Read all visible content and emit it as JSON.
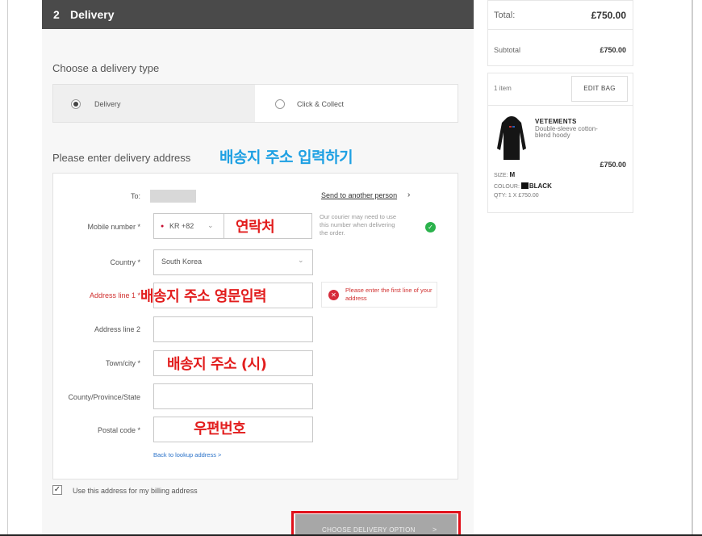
{
  "delivery_step": {
    "number": "2",
    "title": "Delivery"
  },
  "delivery_type": {
    "heading": "Choose a delivery type",
    "options": [
      {
        "label": "Delivery",
        "selected": true
      },
      {
        "label": "Click & Collect",
        "selected": false
      }
    ]
  },
  "address": {
    "heading": "Please enter delivery address",
    "to_label": "To:",
    "send_link": "Send to another person",
    "mobile_label": "Mobile number *",
    "phone_code": "KR +82",
    "courier_note": "Our courier may need to use this number when delivering the order.",
    "country_label": "Country *",
    "country_value": "South Korea",
    "line1_label": "Address line 1 *",
    "line1_error": "Please enter the first line of your address",
    "line2_label": "Address line 2",
    "town_label": "Town/city *",
    "county_label": "County/Province/State",
    "postal_label": "Postal code *",
    "back_link": "Back to lookup address >",
    "billing_label": "Use this address for my billing address",
    "cta_label": "CHOOSE DELIVERY OPTION",
    "cta_chevron": ">"
  },
  "annotations": {
    "address_heading": "배송지 주소 입력하기",
    "mobile": "연락처",
    "line1": "배송지 주소 영문입력",
    "town": "배송지 주소 (시)",
    "postal": "우편번호"
  },
  "summary": {
    "total_label": "Total:",
    "total_value": "£750.00",
    "subtotal_label": "Subtotal",
    "subtotal_value": "£750.00",
    "items_count": "1 item",
    "edit_bag": "EDIT BAG",
    "product": {
      "brand": "VETEMENTS",
      "name": "Double-sleeve cotton-blend hoody",
      "price": "£750.00",
      "size_label": "SIZE:",
      "size": "M",
      "colour_label": "COLOUR:",
      "colour": "BLACK",
      "qty": "QTY: 1 X £750.00"
    }
  },
  "colors": {
    "header_bg": "#4a4a4a",
    "error_red": "#d0302f",
    "annotation_red": "#e21d1d",
    "annotation_blue": "#1ea0e3",
    "success_green": "#2bb24c",
    "link_blue": "#2a72c9"
  },
  "icons": [
    "chevron-right-icon",
    "check-circle-icon",
    "error-x-icon",
    "chevron-down-icon",
    "korea-flag-icon",
    "checkbox-checked-icon"
  ]
}
